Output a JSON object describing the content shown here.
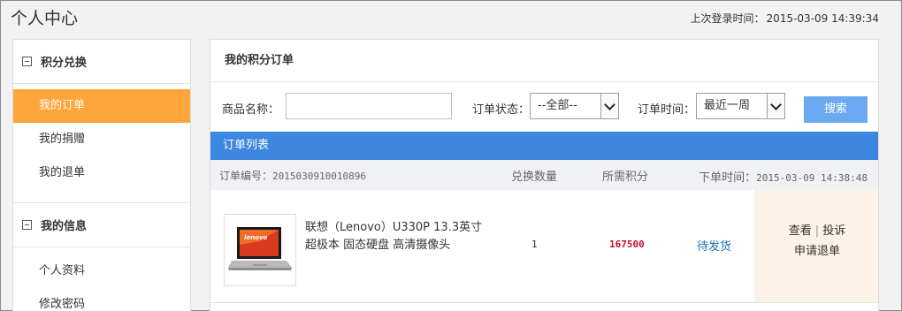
{
  "header": {
    "title": "个人中心",
    "last_login_label": "上次登录时间：",
    "last_login_time": "2015-03-09 14:39:34"
  },
  "sidebar": {
    "section1": {
      "title": "积分兑换",
      "items": [
        "我的订单",
        "我的捐赠",
        "我的退单"
      ]
    },
    "section2": {
      "title": "我的信息",
      "items": [
        "个人资料",
        "修改密码"
      ]
    }
  },
  "main": {
    "title": "我的积分订单",
    "filter": {
      "product_label": "商品名称：",
      "product_value": "",
      "status_label": "订单状态：",
      "status_selected": "--全部--",
      "time_label": "订单时间：",
      "time_selected": "最近一周",
      "search_label": "搜索"
    },
    "list_title": "订单列表",
    "order": {
      "number_label": "订单编号：",
      "number": "2015030910010896",
      "qty_header": "兑换数量",
      "points_header": "所需积分",
      "time_label": "下单时间：",
      "time": "2015-03-09 14:38:48",
      "product_name": "联想（Lenovo）U330P 13.3英寸超极本 固态硬盘 高清摄像头",
      "quantity": "1",
      "points": "167500",
      "status": "待发货",
      "action_view": "查看",
      "action_separator": "|",
      "action_complain": "投诉",
      "action_refund": "申请退单"
    }
  },
  "colors": {
    "active_nav": "#ffa53b",
    "list_bar": "#3d87e0",
    "search_button": "#6aaaf0",
    "points": "#c8102e",
    "status_link": "#1f6fb2",
    "action_bg": "#fdf2e7"
  }
}
